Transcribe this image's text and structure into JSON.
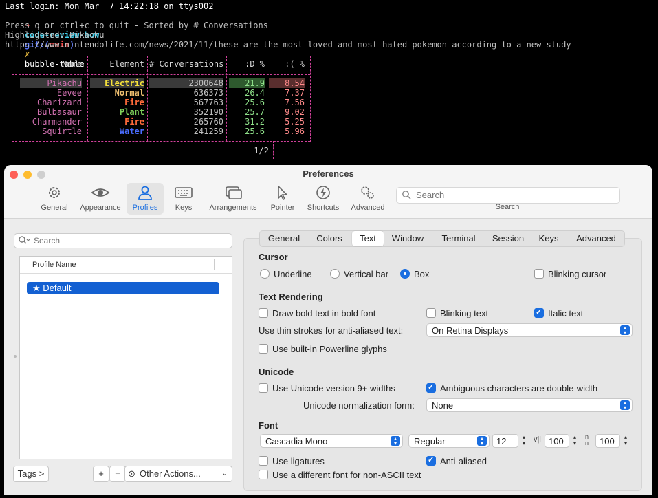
{
  "terminal": {
    "login_line": "Last login: Mon Mar  7 14:22:18 on ttys002",
    "prompt_arrow": "➜",
    "prompt_dir": "code-review-how",
    "prompt_git": "git:(",
    "prompt_branch": "main",
    "prompt_git_close": ")",
    "prompt_mark": "✗",
    "command": "bubble-table",
    "help_line": "Press q or ctrl+c to quit - Sorted by # Conversations",
    "highlighted_line": "Highlighted: Pikachu",
    "url_line": "https://www.nintendolife.com/news/2021/11/these-are-the-most-loved-and-most-hated-pokemon-according-to-a-new-study",
    "table": {
      "headers": [
        "Name",
        "Element",
        "# Conversations",
        ":D %",
        ":( %"
      ],
      "rows": [
        {
          "name": "Pikachu",
          "element": "Electric",
          "conversations": "2300648",
          "happy": "21.9",
          "sad": "8.54",
          "element_color": "#f7e23a"
        },
        {
          "name": "Eevee",
          "element": "Normal",
          "conversations": "636373",
          "happy": "26.4",
          "sad": "7.37",
          "element_color": "#f0c070"
        },
        {
          "name": "Charizard",
          "element": "Fire",
          "conversations": "567763",
          "happy": "25.6",
          "sad": "7.56",
          "element_color": "#ff6a3a"
        },
        {
          "name": "Bulbasaur",
          "element": "Plant",
          "conversations": "352190",
          "happy": "25.7",
          "sad": "9.02",
          "element_color": "#7fd05a"
        },
        {
          "name": "Charmander",
          "element": "Fire",
          "conversations": "265760",
          "happy": "31.2",
          "sad": "5.25",
          "element_color": "#ff6a3a"
        },
        {
          "name": "Squirtle",
          "element": "Water",
          "conversations": "241259",
          "happy": "25.6",
          "sad": "5.96",
          "element_color": "#4a6cff"
        }
      ],
      "page": "1/2"
    }
  },
  "prefs": {
    "title": "Preferences",
    "toolbar": [
      {
        "label": "General",
        "icon": "gear-icon"
      },
      {
        "label": "Appearance",
        "icon": "eye-icon"
      },
      {
        "label": "Profiles",
        "icon": "person-icon"
      },
      {
        "label": "Keys",
        "icon": "keyboard-icon"
      },
      {
        "label": "Arrangements",
        "icon": "windows-icon"
      },
      {
        "label": "Pointer",
        "icon": "cursor-icon"
      },
      {
        "label": "Shortcuts",
        "icon": "lightning-icon"
      },
      {
        "label": "Advanced",
        "icon": "gears-icon"
      }
    ],
    "search": {
      "placeholder": "Search",
      "label": "Search"
    },
    "profiles": {
      "search_placeholder": "Search",
      "column_header": "Profile Name",
      "items": [
        {
          "label": "Default",
          "star": "★"
        }
      ],
      "tags_button": "Tags >",
      "add_button": "+",
      "remove_button": "−",
      "other_actions": "Other Actions..."
    },
    "tabs": [
      "General",
      "Colors",
      "Text",
      "Window",
      "Terminal",
      "Session",
      "Keys",
      "Advanced"
    ],
    "active_tab": "Text",
    "cursor": {
      "title": "Cursor",
      "underline": "Underline",
      "vertical_bar": "Vertical bar",
      "box": "Box",
      "blinking": "Blinking cursor"
    },
    "text_rendering": {
      "title": "Text Rendering",
      "bold_in_bold": "Draw bold text in bold font",
      "blinking_text": "Blinking text",
      "italic_text": "Italic text",
      "thin_strokes_label": "Use thin strokes for anti-aliased text:",
      "thin_strokes_value": "On Retina Displays",
      "powerline": "Use built-in Powerline glyphs"
    },
    "unicode": {
      "title": "Unicode",
      "v9_widths": "Use Unicode version 9+ widths",
      "ambiguous": "Ambiguous characters are double-width",
      "normalization_label": "Unicode normalization form:",
      "normalization_value": "None"
    },
    "font": {
      "title": "Font",
      "family": "Cascadia Mono",
      "style": "Regular",
      "size": "12",
      "h_spacing": "100",
      "v_spacing": "100",
      "ligatures": "Use ligatures",
      "anti_aliased": "Anti-aliased",
      "non_ascii": "Use a different font for non-ASCII text"
    }
  }
}
